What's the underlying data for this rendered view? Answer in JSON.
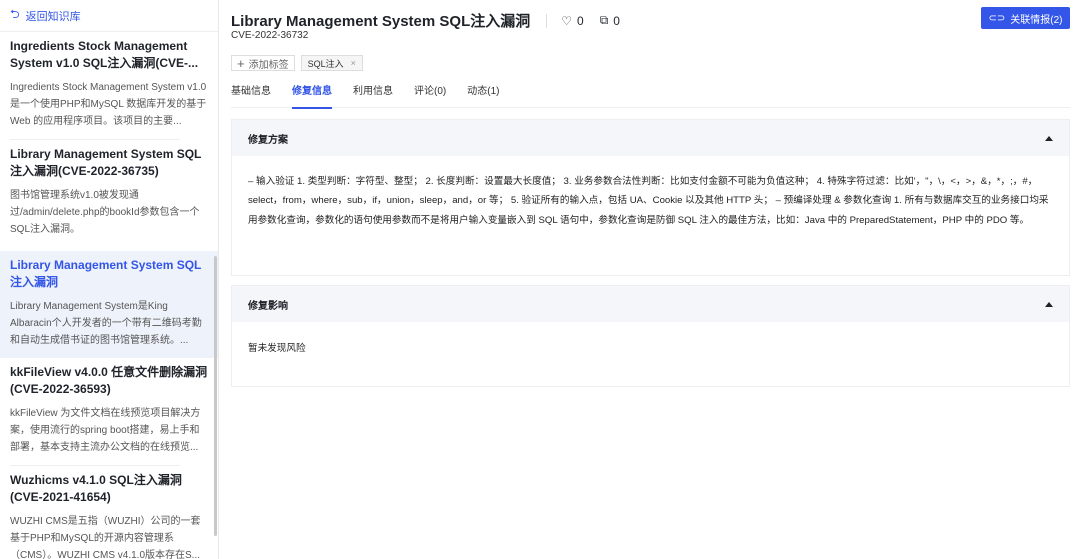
{
  "sidebar": {
    "back_label": "返回知识库",
    "items": [
      {
        "title": "Ingredients Stock Management System v1.0 SQL注入漏洞(CVE-...",
        "desc": "Ingredients Stock Management System v1.0 是一个使用PHP和MySQL 数据库开发的基于 Web 的应用程序项目。该项目的主要..."
      },
      {
        "title": "Library Management System SQL注入漏洞(CVE-2022-36735)",
        "desc": "图书馆管理系统v1.0被发现通过/admin/delete.php的bookId参数包含一个SQL注入漏洞。"
      },
      {
        "title": "Library Management System SQL注入漏洞",
        "desc": "Library Management System是King Albaracin个人开发者的一个带有二维码考勤和自动生成借书证的图书馆管理系统。..."
      },
      {
        "title": "kkFileView v4.0.0 任意文件删除漏洞(CVE-2022-36593)",
        "desc": "kkFileView 为文件文档在线预览项目解决方案，使用流行的spring boot搭建，易上手和部署，基本支持主流办公文档的在线预览..."
      },
      {
        "title": "Wuzhicms v4.1.0 SQL注入漏洞(CVE-2021-41654)",
        "desc": "WUZHI CMS是五指（WUZHI）公司的一套基于PHP和MySQL的开源内容管理系（CMS）。WUZHI CMS v4.1.0版本存在S..."
      }
    ]
  },
  "header": {
    "title": "Library Management System SQL注入漏洞",
    "likes": "0",
    "copies": "0",
    "cve": "CVE-2022-36732",
    "link_button": "关联情报(2)"
  },
  "tags": {
    "add_label": "添加标签",
    "items": [
      "SQL注入"
    ]
  },
  "tabs": [
    "基础信息",
    "修复信息",
    "利用信息",
    "评论(0)",
    "动态(1)"
  ],
  "sections": [
    {
      "title": "修复方案",
      "body": "– 输入验证 1. 类型判断：字符型、整型； 2. 长度判断：设置最大长度值； 3. 业务参数合法性判断：比如支付金额不可能为负值这种； 4. 特殊字符过滤：比如'，\"，\\，<，>，&，*，;，#，select，from，where，sub，if，union，sleep，and，or 等； 5. 验证所有的输入点，包括 UA、Cookie 以及其他 HTTP 头； – 预编译处理 & 参数化查询 1. 所有与数据库交互的业务接口均采用参数化查询，参数化的语句使用参数而不是将用户输入变量嵌入到 SQL 语句中，参数化查询是防御 SQL 注入的最佳方法，比如：Java 中的 PreparedStatement，PHP 中的 PDO 等。"
    },
    {
      "title": "修复影响",
      "body": "暂未发现风险"
    }
  ],
  "colors": {
    "accent": "#3355e8"
  }
}
